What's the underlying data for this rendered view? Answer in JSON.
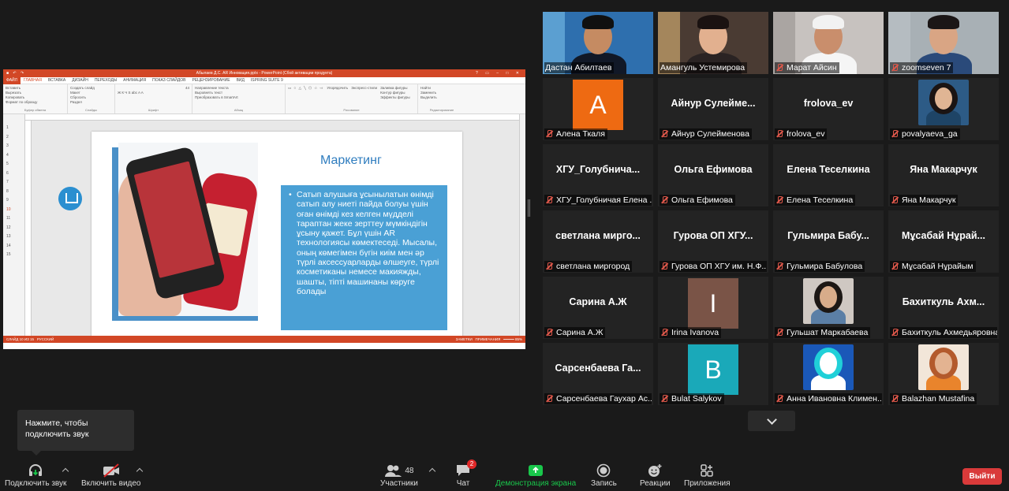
{
  "ppt": {
    "window_title": "Абылаев Д.С. AR Инновация.pptx - PowerPoint (Сбой активации продукта)",
    "tabs": [
      "ФАЙЛ",
      "ГЛАВНАЯ",
      "ВСТАВКА",
      "ДИЗАЙН",
      "ПЕРЕХОДЫ",
      "АНИМАЦИЯ",
      "ПОКАЗ СЛАЙДОВ",
      "РЕЦЕНЗИРОВАНИЕ",
      "ВИД",
      "ISPRING SUITE 9"
    ],
    "ribbon": {
      "clipboard": {
        "paste": "Вставить",
        "cut": "Вырезать",
        "copy": "Копировать",
        "format": "Формат по образцу",
        "label": "Буфер обмена"
      },
      "slides": {
        "create": "Создать слайд",
        "layout": "Макет",
        "reset": "Сбросить",
        "section": "Раздел",
        "label": "Слайды"
      },
      "font": {
        "label": "Шрифт",
        "size": "44"
      },
      "paragraph": {
        "label": "Абзац",
        "direction": "Направление текста",
        "align": "Выровнять текст",
        "smartart": "Преобразовать в SmartArt"
      },
      "drawing": {
        "label": "Рисование",
        "arrange": "Упорядочить",
        "styles": "Экспресс-стили",
        "fill": "Заливка фигуры",
        "outline": "Контур фигуры",
        "effects": "Эффекты фигуры"
      },
      "editing": {
        "label": "Редактирование",
        "find": "Найти",
        "replace": "Заменить",
        "select": "Выделить"
      }
    },
    "thumbs": [
      "1",
      "2",
      "3",
      "4",
      "5",
      "6",
      "7",
      "8",
      "9",
      "10",
      "11",
      "12",
      "13",
      "14",
      "15"
    ],
    "slide": {
      "title": "Маркетинг",
      "body": "Сатып алушыға ұсынылатын өнімді сатып алу ниеті пайда болуы үшін оған өнімді кез келген мүдделі тараптан жеке зерттеу мүмкіндігін ұсыну қажет. Бұл үшін AR технологиясы көмектеседі. Мысалы, оның көмегімен бүгін киім мен әр түрлі аксессуарларды өлшеуге, түрлі косметиканы немесе макияжды, шашты, тіпті машинаны көруге болады"
    },
    "status": {
      "slide": "СЛАЙД 10 ИЗ 15",
      "lang": "РУССКИЙ",
      "notes": "ЗАМЕТКИ",
      "comments": "ПРИМЕЧАНИЯ",
      "zoom": "85%"
    }
  },
  "participants": [
    {
      "name": "Дастан Абилтаев",
      "muted": false,
      "kind": "video"
    },
    {
      "name": "Амангуль Устемирова",
      "muted": false,
      "kind": "video"
    },
    {
      "name": "Марат Айсин",
      "muted": true,
      "kind": "video"
    },
    {
      "name": "zoomseven 7",
      "muted": true,
      "kind": "video"
    },
    {
      "name": "Алена Ткаля",
      "muted": true,
      "kind": "letter",
      "letter": "А"
    },
    {
      "name": "Айнур Сулейменова",
      "display": "Айнур  Сулейме...",
      "muted": true,
      "kind": "name"
    },
    {
      "name": "frolova_ev",
      "display": "frolova_ev",
      "muted": true,
      "kind": "name"
    },
    {
      "name": "povalyaeva_ga",
      "muted": true,
      "kind": "photo"
    },
    {
      "name": "ХГУ_Голубничая Елена ...",
      "display": "ХГУ_Голубнича...",
      "muted": true,
      "kind": "name"
    },
    {
      "name": "Ольга Ефимова",
      "display": "Ольга Ефимова",
      "muted": true,
      "kind": "name"
    },
    {
      "name": "Елена Теселкина",
      "display": "Елена Теселкина",
      "muted": true,
      "kind": "name"
    },
    {
      "name": "Яна Макарчук",
      "display": "Яна Макарчук",
      "muted": true,
      "kind": "name"
    },
    {
      "name": "светлана миргород",
      "display": "светлана  мирго...",
      "muted": true,
      "kind": "name"
    },
    {
      "name": "Гурова ОП ХГУ им. Н.Ф....",
      "display": "Гурова ОП ХГУ...",
      "muted": true,
      "kind": "name"
    },
    {
      "name": "Гульмира Бабулова",
      "display": "Гульмира  Бабу...",
      "muted": true,
      "kind": "name"
    },
    {
      "name": "Мұсабай Нұрайым",
      "display": "Мұсабай Нұрай...",
      "muted": true,
      "kind": "name"
    },
    {
      "name": "Сарина А.Ж",
      "display": "Сарина А.Ж",
      "muted": true,
      "kind": "name"
    },
    {
      "name": "Irina Ivanova",
      "muted": true,
      "kind": "letter",
      "letter": "I"
    },
    {
      "name": "Гульшат Маркабаева",
      "muted": true,
      "kind": "photo"
    },
    {
      "name": "Бахиткуль Ахмедьяровна",
      "display": "Бахиткуль  Ахм...",
      "muted": true,
      "kind": "name"
    },
    {
      "name": "Сарсенбаева Гаухар Ас...",
      "display": "Сарсенбаева  Га...",
      "muted": true,
      "kind": "name"
    },
    {
      "name": "Bulat Salykov",
      "muted": true,
      "kind": "letter",
      "letter": "B"
    },
    {
      "name": "Анна Ивановна Климен...",
      "muted": true,
      "kind": "photo"
    },
    {
      "name": "Balazhan Mustafina",
      "muted": true,
      "kind": "photo"
    }
  ],
  "tooltip": "Нажмите, чтобы подключить звук",
  "toolbar": {
    "audio": "Подключить звук",
    "video": "Включить видео",
    "participants": "Участники",
    "participants_count": "48",
    "chat": "Чат",
    "chat_badge": "2",
    "share": "Демонстрация экрана",
    "record": "Запись",
    "reactions": "Реакции",
    "apps": "Приложения",
    "leave": "Выйти"
  },
  "colors": {
    "background": "#1a1a1a",
    "tile": "#232323",
    "active_speaker": "#e8d94a",
    "leave": "#d93a3a",
    "share_green": "#19c74b",
    "ppt_accent": "#d24726",
    "slide_title": "#2f7dbf",
    "slide_box": "#4aa0d5",
    "letter_A": "#ee6a12",
    "letter_I": "#7a5447",
    "letter_B": "#1aa9b9"
  }
}
